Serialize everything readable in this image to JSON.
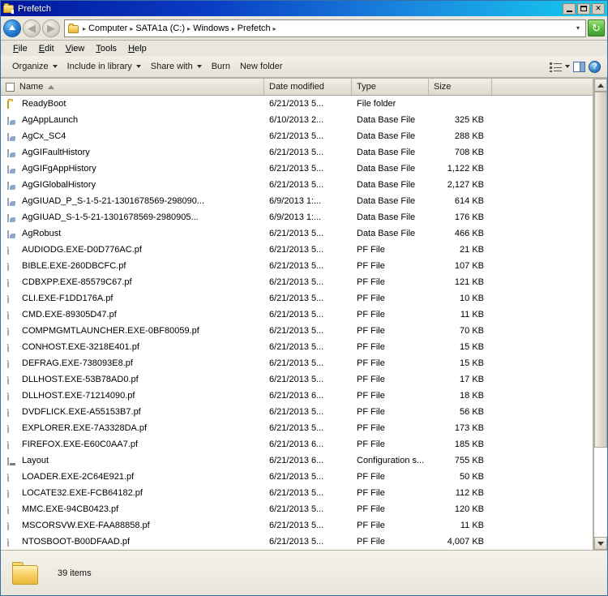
{
  "window": {
    "title": "Prefetch",
    "icon": "folder-icon",
    "buttons": {
      "minimize": "minimize-button",
      "maximize": "maximize-button",
      "close": "✕"
    }
  },
  "navbar": {
    "up_tooltip": "Up",
    "back_glyph": "◀",
    "forward_glyph": "▶",
    "breadcrumbs": [
      "Computer",
      "SATA1a (C:)",
      "Windows",
      "Prefetch"
    ],
    "separator": "▸",
    "dropdown_glyph": "▾",
    "refresh_glyph": "↻"
  },
  "menubar": {
    "items": [
      {
        "label": "File",
        "accel": "F"
      },
      {
        "label": "Edit",
        "accel": "E"
      },
      {
        "label": "View",
        "accel": "V"
      },
      {
        "label": "Tools",
        "accel": "T"
      },
      {
        "label": "Help",
        "accel": "H"
      }
    ]
  },
  "commandbar": {
    "items": [
      {
        "label": "Organize",
        "has_caret": true
      },
      {
        "label": "Include in library",
        "has_caret": true
      },
      {
        "label": "Share with",
        "has_caret": true
      },
      {
        "label": "Burn",
        "has_caret": false
      },
      {
        "label": "New folder",
        "has_caret": false
      }
    ],
    "icons": {
      "views": "view-options-icon",
      "views_caret": "chevron-down-icon",
      "preview_pane": "preview-pane-icon",
      "help": "?"
    }
  },
  "columns": {
    "name": "Name",
    "date": "Date modified",
    "type": "Type",
    "size": "Size",
    "sort_column": "Name",
    "sort_direction": "ascending"
  },
  "files": [
    {
      "name": "ReadyBoot",
      "date": "6/21/2013 5...",
      "type": "File folder",
      "size": "",
      "icon": "folder"
    },
    {
      "name": "AgAppLaunch",
      "date": "6/10/2013 2...",
      "type": "Data Base File",
      "size": "325 KB",
      "icon": "db"
    },
    {
      "name": "AgCx_SC4",
      "date": "6/21/2013 5...",
      "type": "Data Base File",
      "size": "288 KB",
      "icon": "db"
    },
    {
      "name": "AgGIFaultHistory",
      "date": "6/21/2013 5...",
      "type": "Data Base File",
      "size": "708 KB",
      "icon": "db"
    },
    {
      "name": "AgGIFgAppHistory",
      "date": "6/21/2013 5...",
      "type": "Data Base File",
      "size": "1,122 KB",
      "icon": "db"
    },
    {
      "name": "AgGIGlobalHistory",
      "date": "6/21/2013 5...",
      "type": "Data Base File",
      "size": "2,127 KB",
      "icon": "db"
    },
    {
      "name": "AgGIUAD_P_S-1-5-21-1301678569-298090...",
      "date": "6/9/2013 1:...",
      "type": "Data Base File",
      "size": "614 KB",
      "icon": "db"
    },
    {
      "name": "AgGIUAD_S-1-5-21-1301678569-2980905...",
      "date": "6/9/2013 1:...",
      "type": "Data Base File",
      "size": "176 KB",
      "icon": "db"
    },
    {
      "name": "AgRobust",
      "date": "6/21/2013 5...",
      "type": "Data Base File",
      "size": "466 KB",
      "icon": "db"
    },
    {
      "name": "AUDIODG.EXE-D0D776AC.pf",
      "date": "6/21/2013 5...",
      "type": "PF File",
      "size": "21 KB",
      "icon": "pf"
    },
    {
      "name": "BIBLE.EXE-260DBCFC.pf",
      "date": "6/21/2013 5...",
      "type": "PF File",
      "size": "107 KB",
      "icon": "pf"
    },
    {
      "name": "CDBXPP.EXE-85579C67.pf",
      "date": "6/21/2013 5...",
      "type": "PF File",
      "size": "121 KB",
      "icon": "pf"
    },
    {
      "name": "CLI.EXE-F1DD176A.pf",
      "date": "6/21/2013 5...",
      "type": "PF File",
      "size": "10 KB",
      "icon": "pf"
    },
    {
      "name": "CMD.EXE-89305D47.pf",
      "date": "6/21/2013 5...",
      "type": "PF File",
      "size": "11 KB",
      "icon": "pf"
    },
    {
      "name": "COMPMGMTLAUNCHER.EXE-0BF80059.pf",
      "date": "6/21/2013 5...",
      "type": "PF File",
      "size": "70 KB",
      "icon": "pf"
    },
    {
      "name": "CONHOST.EXE-3218E401.pf",
      "date": "6/21/2013 5...",
      "type": "PF File",
      "size": "15 KB",
      "icon": "pf"
    },
    {
      "name": "DEFRAG.EXE-738093E8.pf",
      "date": "6/21/2013 5...",
      "type": "PF File",
      "size": "15 KB",
      "icon": "pf"
    },
    {
      "name": "DLLHOST.EXE-53B78AD0.pf",
      "date": "6/21/2013 5...",
      "type": "PF File",
      "size": "17 KB",
      "icon": "pf"
    },
    {
      "name": "DLLHOST.EXE-71214090.pf",
      "date": "6/21/2013 6...",
      "type": "PF File",
      "size": "18 KB",
      "icon": "pf"
    },
    {
      "name": "DVDFLICK.EXE-A55153B7.pf",
      "date": "6/21/2013 5...",
      "type": "PF File",
      "size": "56 KB",
      "icon": "pf"
    },
    {
      "name": "EXPLORER.EXE-7A3328DA.pf",
      "date": "6/21/2013 5...",
      "type": "PF File",
      "size": "173 KB",
      "icon": "pf"
    },
    {
      "name": "FIREFOX.EXE-E60C0AA7.pf",
      "date": "6/21/2013 6...",
      "type": "PF File",
      "size": "185 KB",
      "icon": "pf"
    },
    {
      "name": "Layout",
      "date": "6/21/2013 6...",
      "type": "Configuration s...",
      "size": "755 KB",
      "icon": "cfg"
    },
    {
      "name": "LOADER.EXE-2C64E921.pf",
      "date": "6/21/2013 5...",
      "type": "PF File",
      "size": "50 KB",
      "icon": "pf"
    },
    {
      "name": "LOCATE32.EXE-FCB64182.pf",
      "date": "6/21/2013 5...",
      "type": "PF File",
      "size": "112 KB",
      "icon": "pf"
    },
    {
      "name": "MMC.EXE-94CB0423.pf",
      "date": "6/21/2013 5...",
      "type": "PF File",
      "size": "120 KB",
      "icon": "pf"
    },
    {
      "name": "MSCORSVW.EXE-FAA88858.pf",
      "date": "6/21/2013 5...",
      "type": "PF File",
      "size": "11 KB",
      "icon": "pf"
    },
    {
      "name": "NTOSBOOT-B00DFAAD.pf",
      "date": "6/21/2013 5...",
      "type": "PF File",
      "size": "4,007 KB",
      "icon": "pf"
    }
  ],
  "scrollbar": {
    "up_glyph": "▲",
    "down_glyph": "▼",
    "thumb_position_percent": 0,
    "thumb_size_percent": 80
  },
  "statusbar": {
    "item_count": "39 items",
    "icon": "folder-icon"
  }
}
